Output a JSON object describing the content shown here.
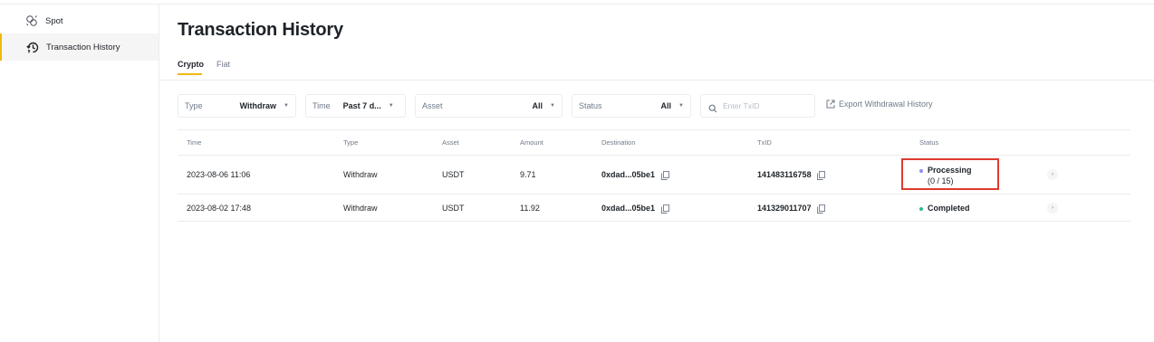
{
  "sidebar": {
    "items": [
      {
        "label": "Spot",
        "icon": "spot-icon"
      },
      {
        "label": "Transaction History",
        "icon": "history-icon",
        "active": true
      }
    ]
  },
  "header": {
    "title": "Transaction History"
  },
  "tabs": [
    {
      "label": "Crypto",
      "active": true
    },
    {
      "label": "Fiat",
      "active": false
    }
  ],
  "filters": {
    "type": {
      "label": "Type",
      "value": "Withdraw"
    },
    "time": {
      "label": "Time",
      "value": "Past 7 d..."
    },
    "asset": {
      "label": "Asset",
      "value": "All"
    },
    "status": {
      "label": "Status",
      "value": "All"
    },
    "search": {
      "placeholder": "Enter TxID",
      "value": ""
    },
    "export_label": "Export Withdrawal History"
  },
  "table": {
    "columns": [
      "Time",
      "Type",
      "Asset",
      "Amount",
      "Destination",
      "TxID",
      "Status"
    ],
    "rows": [
      {
        "time": "2023-08-06 11:06",
        "type": "Withdraw",
        "asset": "USDT",
        "amount": "9.71",
        "destination": "0xdad...05be1",
        "txid": "141483116758",
        "status": "Processing",
        "status_detail": "(0 / 15)",
        "status_color": "#8b8ef0"
      },
      {
        "time": "2023-08-02 17:48",
        "type": "Withdraw",
        "asset": "USDT",
        "amount": "11.92",
        "destination": "0xdad...05be1",
        "txid": "141329011707",
        "status": "Completed",
        "status_detail": "",
        "status_color": "#2ebd85"
      }
    ]
  },
  "colors": {
    "accent": "#f0b90b",
    "highlight": "#e03a2f"
  }
}
